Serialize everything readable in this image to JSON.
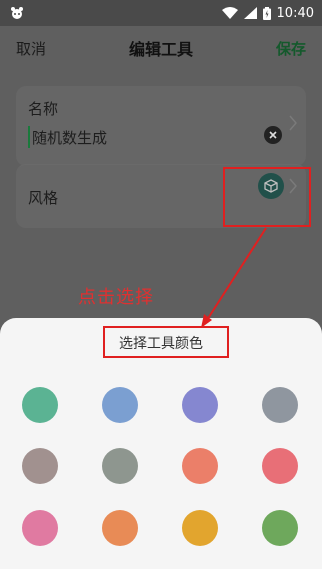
{
  "status_bar": {
    "time": "10:40"
  },
  "header": {
    "cancel_label": "取消",
    "title": "编辑工具",
    "save_label": "保存"
  },
  "form": {
    "name_label": "名称",
    "name_value": "随机数生成",
    "style_label": "风格"
  },
  "annotation": {
    "hint_text": "点击选择"
  },
  "sheet": {
    "title": "选择工具颜色",
    "colors": [
      "#5bb393",
      "#7b9fd1",
      "#8587d0",
      "#8f969f",
      "#a1918f",
      "#8e968f",
      "#eb7f69",
      "#e86f77",
      "#e07aa1",
      "#e88b56",
      "#e2a52e",
      "#6ea85c"
    ]
  }
}
